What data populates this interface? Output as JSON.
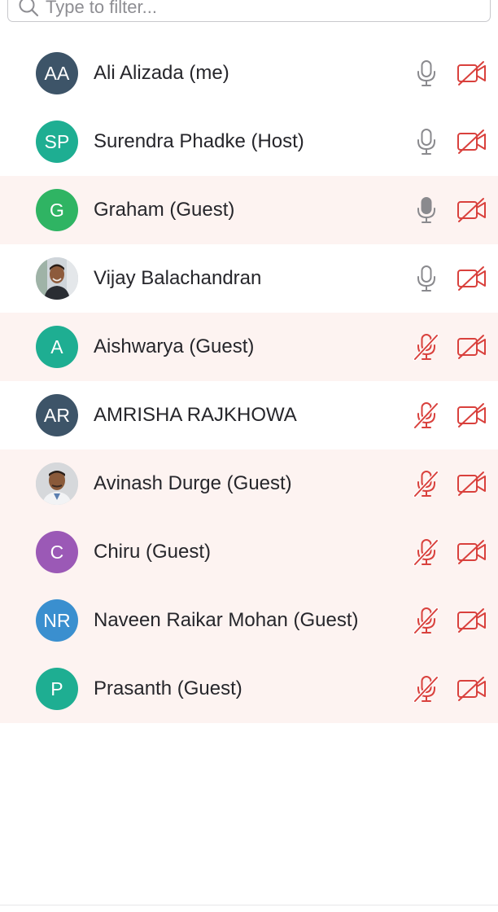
{
  "filter": {
    "placeholder": "Type to filter...",
    "value": ""
  },
  "colors": {
    "muted_red": "#d9413d",
    "mic_gray": "#8a8a8e",
    "tinted_row": "#fdf3f1"
  },
  "participants": [
    {
      "initials": "AA",
      "name": "Ali Alizada (me)",
      "avatar_color": "#3d5468",
      "avatar_type": "initials",
      "mic": "on",
      "video": "off",
      "tinted": false
    },
    {
      "initials": "SP",
      "name": "Surendra Phadke (Host)",
      "avatar_color": "#1eae92",
      "avatar_type": "initials",
      "mic": "on",
      "video": "off",
      "tinted": false
    },
    {
      "initials": "G",
      "name": "Graham (Guest)",
      "avatar_color": "#2fb463",
      "avatar_type": "initials",
      "mic": "on",
      "video": "off",
      "tinted": true
    },
    {
      "initials": "",
      "name": "Vijay Balachandran",
      "avatar_color": "#c7cdd2",
      "avatar_type": "photo",
      "mic": "on",
      "video": "off",
      "tinted": false
    },
    {
      "initials": "A",
      "name": "Aishwarya (Guest)",
      "avatar_color": "#1eae92",
      "avatar_type": "initials",
      "mic": "muted",
      "video": "off",
      "tinted": true
    },
    {
      "initials": "AR",
      "name": "AMRISHA RAJKHOWA",
      "avatar_color": "#3d5468",
      "avatar_type": "initials",
      "mic": "muted",
      "video": "off",
      "tinted": false
    },
    {
      "initials": "",
      "name": "Avinash Durge (Guest)",
      "avatar_color": "#d0d3d6",
      "avatar_type": "photo",
      "mic": "muted",
      "video": "off",
      "tinted": true
    },
    {
      "initials": "C",
      "name": "Chiru (Guest)",
      "avatar_color": "#9b59b6",
      "avatar_type": "initials",
      "mic": "muted",
      "video": "off",
      "tinted": true
    },
    {
      "initials": "NR",
      "name": "Naveen Raikar Mohan (Guest)",
      "avatar_color": "#3a8fcf",
      "avatar_type": "initials",
      "mic": "muted",
      "video": "off",
      "tinted": true
    },
    {
      "initials": "P",
      "name": "Prasanth (Guest)",
      "avatar_color": "#1eae92",
      "avatar_type": "initials",
      "mic": "muted",
      "video": "off",
      "tinted": true
    }
  ]
}
